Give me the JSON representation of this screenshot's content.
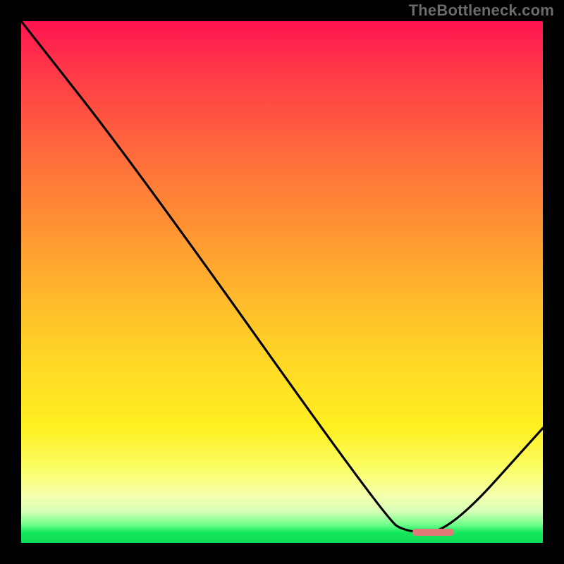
{
  "watermark": "TheBottleneck.com",
  "chart_data": {
    "type": "line",
    "title": "",
    "xlabel": "",
    "ylabel": "",
    "xlim": [
      0,
      100
    ],
    "ylim": [
      0,
      100
    ],
    "grid": false,
    "legend": false,
    "series": [
      {
        "name": "curve",
        "x": [
          0,
          22,
          70,
          74,
          82,
          100
        ],
        "values": [
          100,
          72,
          4.5,
          2,
          2,
          22
        ]
      }
    ],
    "annotations": [
      {
        "name": "optimal-marker",
        "x_start": 75,
        "x_end": 83,
        "y": 2
      }
    ],
    "background_gradient_stops": [
      {
        "pct": 0,
        "color": "#ff1450"
      },
      {
        "pct": 10,
        "color": "#ff3a47"
      },
      {
        "pct": 25,
        "color": "#ff6a3c"
      },
      {
        "pct": 38,
        "color": "#ff8f34"
      },
      {
        "pct": 52,
        "color": "#ffb62c"
      },
      {
        "pct": 65,
        "color": "#ffd726"
      },
      {
        "pct": 78,
        "color": "#fff021"
      },
      {
        "pct": 86,
        "color": "#fbff69"
      },
      {
        "pct": 91,
        "color": "#f4ffae"
      },
      {
        "pct": 94,
        "color": "#d7ffb8"
      },
      {
        "pct": 96.5,
        "color": "#6fff8a"
      },
      {
        "pct": 98,
        "color": "#14e85d"
      },
      {
        "pct": 100,
        "color": "#0ddb55"
      }
    ],
    "marker_color": "#e07a7a",
    "line_color": "#000000"
  }
}
